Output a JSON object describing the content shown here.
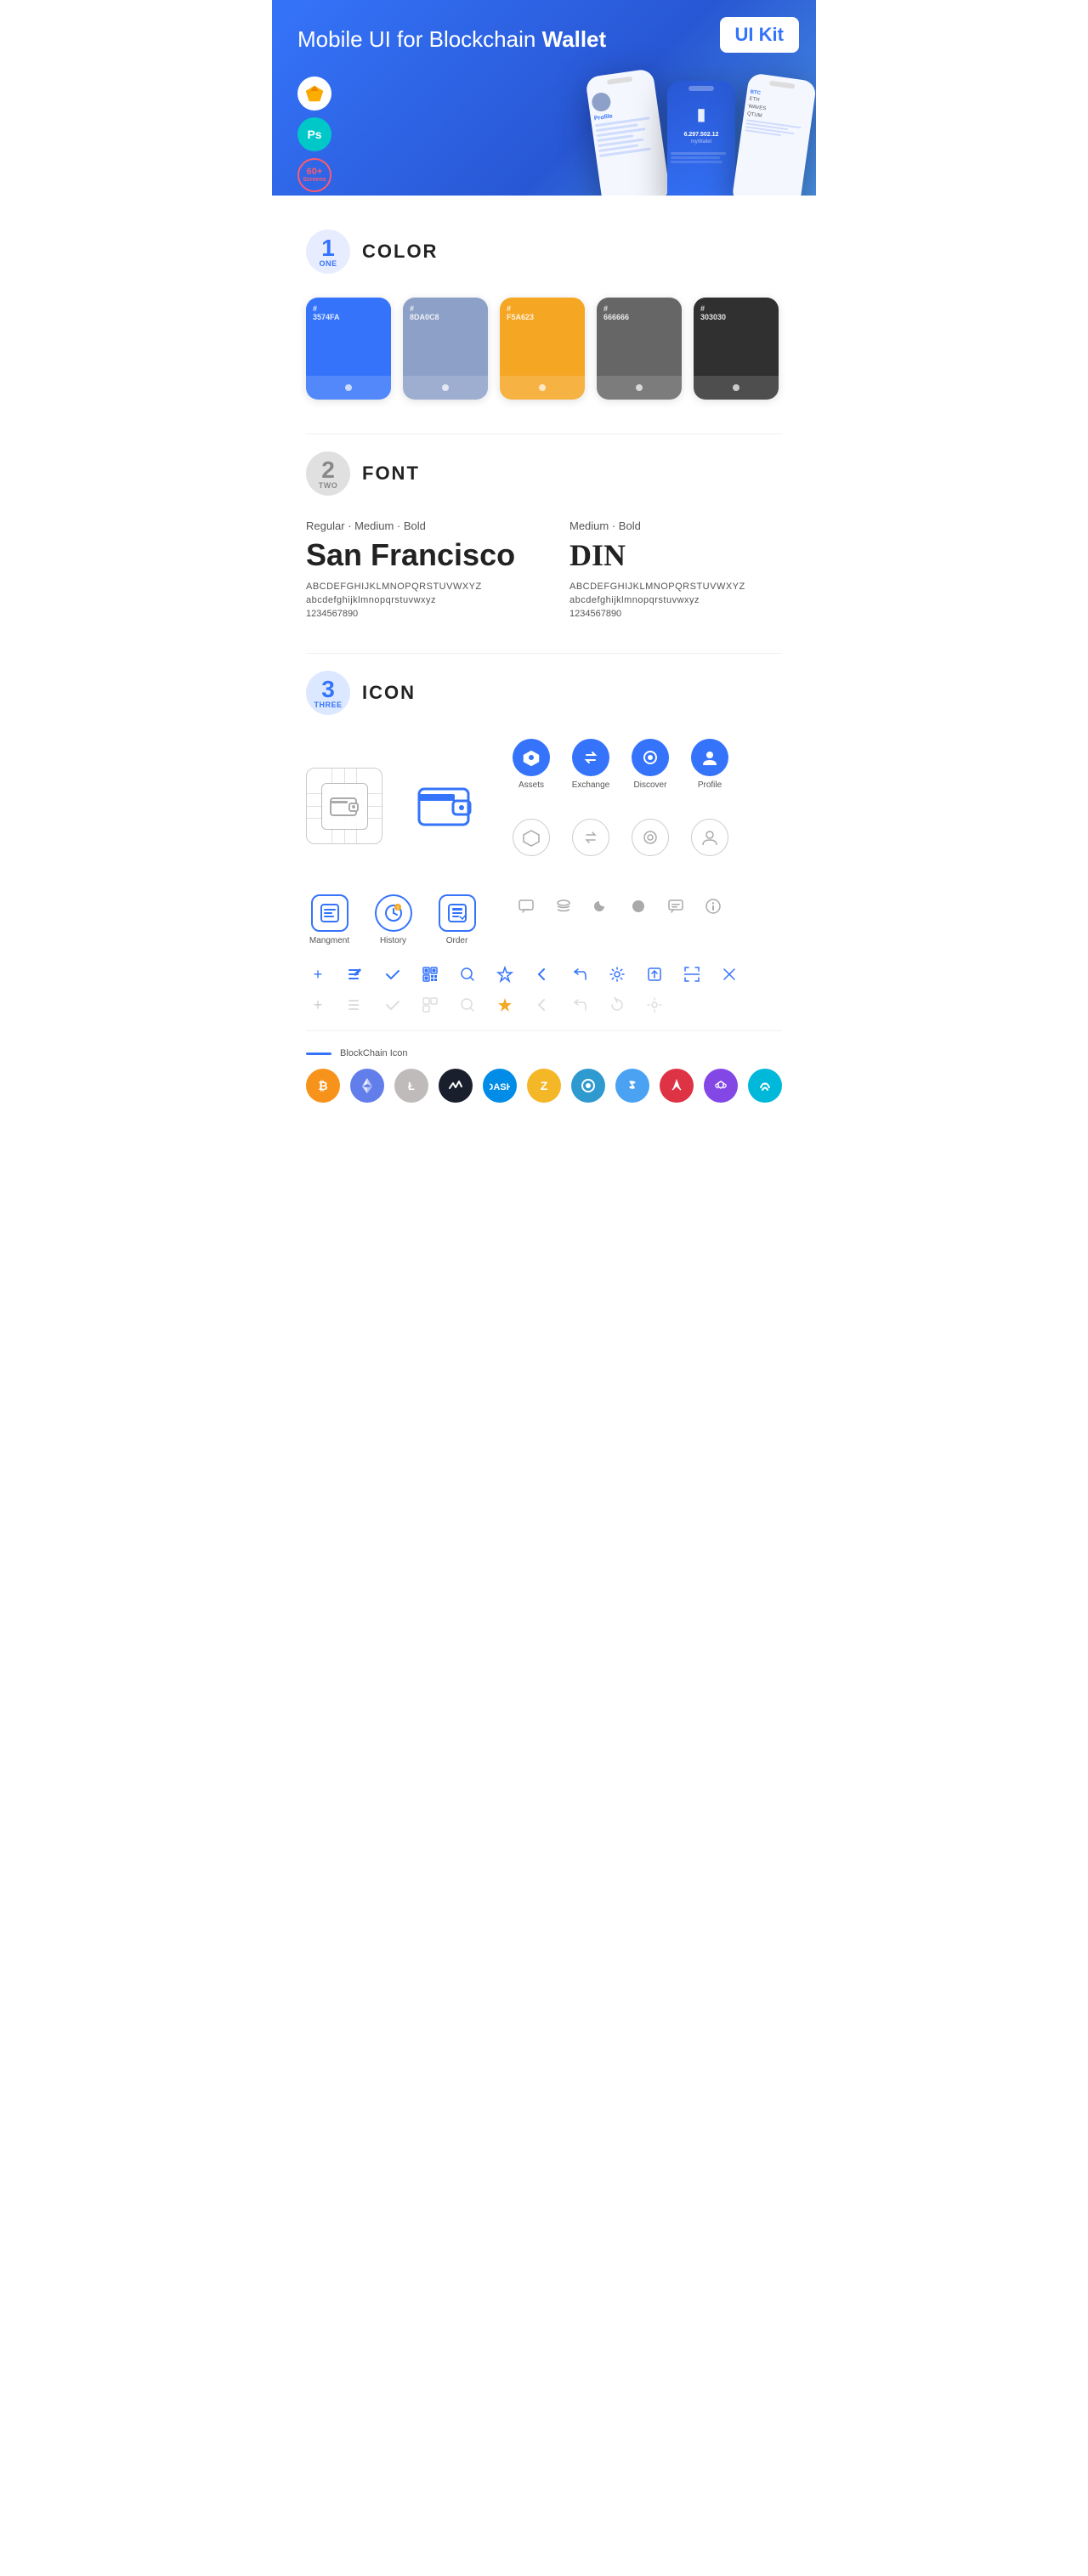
{
  "hero": {
    "title": "Mobile UI for Blockchain ",
    "title_bold": "Wallet",
    "ui_kit_label": "UI Kit",
    "badge_ps": "Ps",
    "badge_screens": "60+\nScreens"
  },
  "section1": {
    "number": "1",
    "label": "ONE",
    "title": "COLOR",
    "colors": [
      {
        "hex": "#3574FA",
        "code": "3574FA"
      },
      {
        "hex": "#8DA0C8",
        "code": "8DA0C8"
      },
      {
        "hex": "#F5A623",
        "code": "F5A623"
      },
      {
        "hex": "#666666",
        "code": "666666"
      },
      {
        "hex": "#303030",
        "code": "303030"
      }
    ]
  },
  "section2": {
    "number": "2",
    "label": "TWO",
    "title": "FONT",
    "font1": {
      "styles": "Regular · Medium · Bold",
      "name": "San Francisco",
      "upper": "ABCDEFGHIJKLMNOPQRSTUVWXYZ",
      "lower": "abcdefghijklmnopqrstuvwxyz",
      "numbers": "1234567890"
    },
    "font2": {
      "styles": "Medium · Bold",
      "name": "DIN",
      "upper": "ABCDEFGHIJKLMNOPQRSTUVWXYZ",
      "lower": "abcdefghijklmnopqrstuvwxyz",
      "numbers": "1234567890"
    }
  },
  "section3": {
    "number": "3",
    "label": "THREE",
    "title": "ICON",
    "nav_icons": [
      {
        "label": "Assets"
      },
      {
        "label": "Exchange"
      },
      {
        "label": "Discover"
      },
      {
        "label": "Profile"
      }
    ],
    "app_icons": [
      {
        "label": "Mangment"
      },
      {
        "label": "History"
      },
      {
        "label": "Order"
      }
    ],
    "blockchain_label": "BlockChain Icon"
  }
}
